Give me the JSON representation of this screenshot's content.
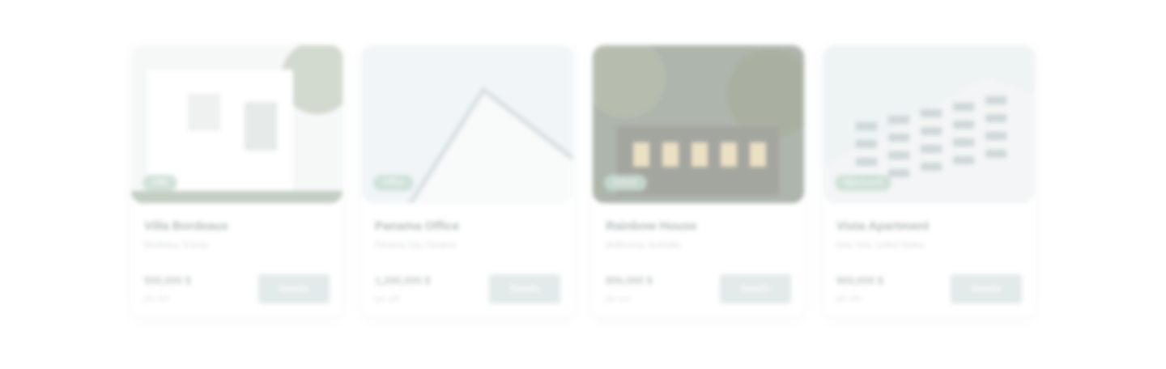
{
  "cards": [
    {
      "tag": "Villa",
      "title": "Villa Bordeaux",
      "address": "Bordeaux, France",
      "price": "500,000 $",
      "unit": "per unit",
      "button": "Details",
      "photo_theme": "villa",
      "sky": "#eef2f1",
      "wall": "#ffffff",
      "accent": "#8aa089"
    },
    {
      "tag": "Office",
      "title": "Panama Office",
      "address": "Panama City, Panama",
      "price": "1,200,000 $",
      "unit": "per unit",
      "button": "Details",
      "photo_theme": "office",
      "sky": "#e4edf2",
      "wall": "#f4f6f7",
      "accent": "#b5c3c7"
    },
    {
      "tag": "House",
      "title": "Rainbow House",
      "address": "Melbourne, Australia",
      "price": "800,000 $",
      "unit": "per unit",
      "button": "Details",
      "photo_theme": "house",
      "sky": "#5f6d5c",
      "wall": "#4a4f42",
      "accent": "#d9c28a"
    },
    {
      "tag": "Apartment",
      "title": "Vista Apartment",
      "address": "New York, United States",
      "price": "900,000 $",
      "unit": "per unit",
      "button": "Details",
      "photo_theme": "apartment",
      "sky": "#dfe8ea",
      "wall": "#e9edee",
      "accent": "#9fb0b3"
    }
  ]
}
